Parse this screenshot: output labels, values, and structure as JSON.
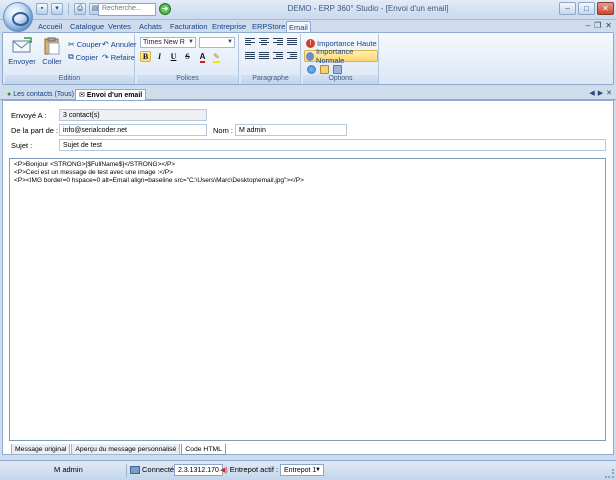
{
  "window": {
    "title": "DEMO - ERP 360° Studio - [Envoi d'un email]"
  },
  "search": {
    "placeholder": "Recherche..."
  },
  "ribbon_tabs": [
    "Accueil",
    "Catalogue",
    "Ventes",
    "Achats",
    "Facturation",
    "Entreprise",
    "ERPStore",
    "Email"
  ],
  "ribbon": {
    "edition": {
      "label": "Edition",
      "envoyer": "Envoyer",
      "coller": "Coller",
      "couper": "Couper",
      "copier": "Copier",
      "annuler": "Annuler",
      "refaire": "Refaire"
    },
    "polices": {
      "label": "Polices",
      "font": "Times New R",
      "size": "",
      "bold": "B",
      "italic": "I",
      "underline": "U",
      "strike": "S"
    },
    "paragraphe": {
      "label": "Paragraphe"
    },
    "options": {
      "label": "Options",
      "high": "Importance Haute",
      "normal": "Importance Normale"
    }
  },
  "doc_tabs": [
    "Les contacts (Tous)",
    "Envoi d'un email"
  ],
  "form": {
    "envoye_label": "Envoyé A :",
    "envoye_value": "3 contact(s)",
    "from_label": "De la part de :",
    "from_value": "info@serialcoder.net",
    "nom_label": "Nom :",
    "nom_value": "M admin",
    "sujet_label": "Sujet :",
    "sujet_value": "Sujet de test"
  },
  "editor_lines": [
    "<P>Bonjour <STRONG>[$FullName$]</STRONG></P>",
    "<P>Ceci est un message de test avec une image :</P>",
    "<P><IMG border=0 hspace=0 alt=Email align=baseline src=\"C:\\Users\\Marc\\Desktop\\email.jpg\"></P>"
  ],
  "bottom_tabs": [
    "Message original",
    "Aperçu du message personnalisé",
    "Code HTML"
  ],
  "status": {
    "user": "M admin",
    "connected": "Connecté",
    "version": "2.3.1312.170",
    "entrepot_label": "Entrepot actif :",
    "entrepot_value": "Entrepot 1"
  }
}
